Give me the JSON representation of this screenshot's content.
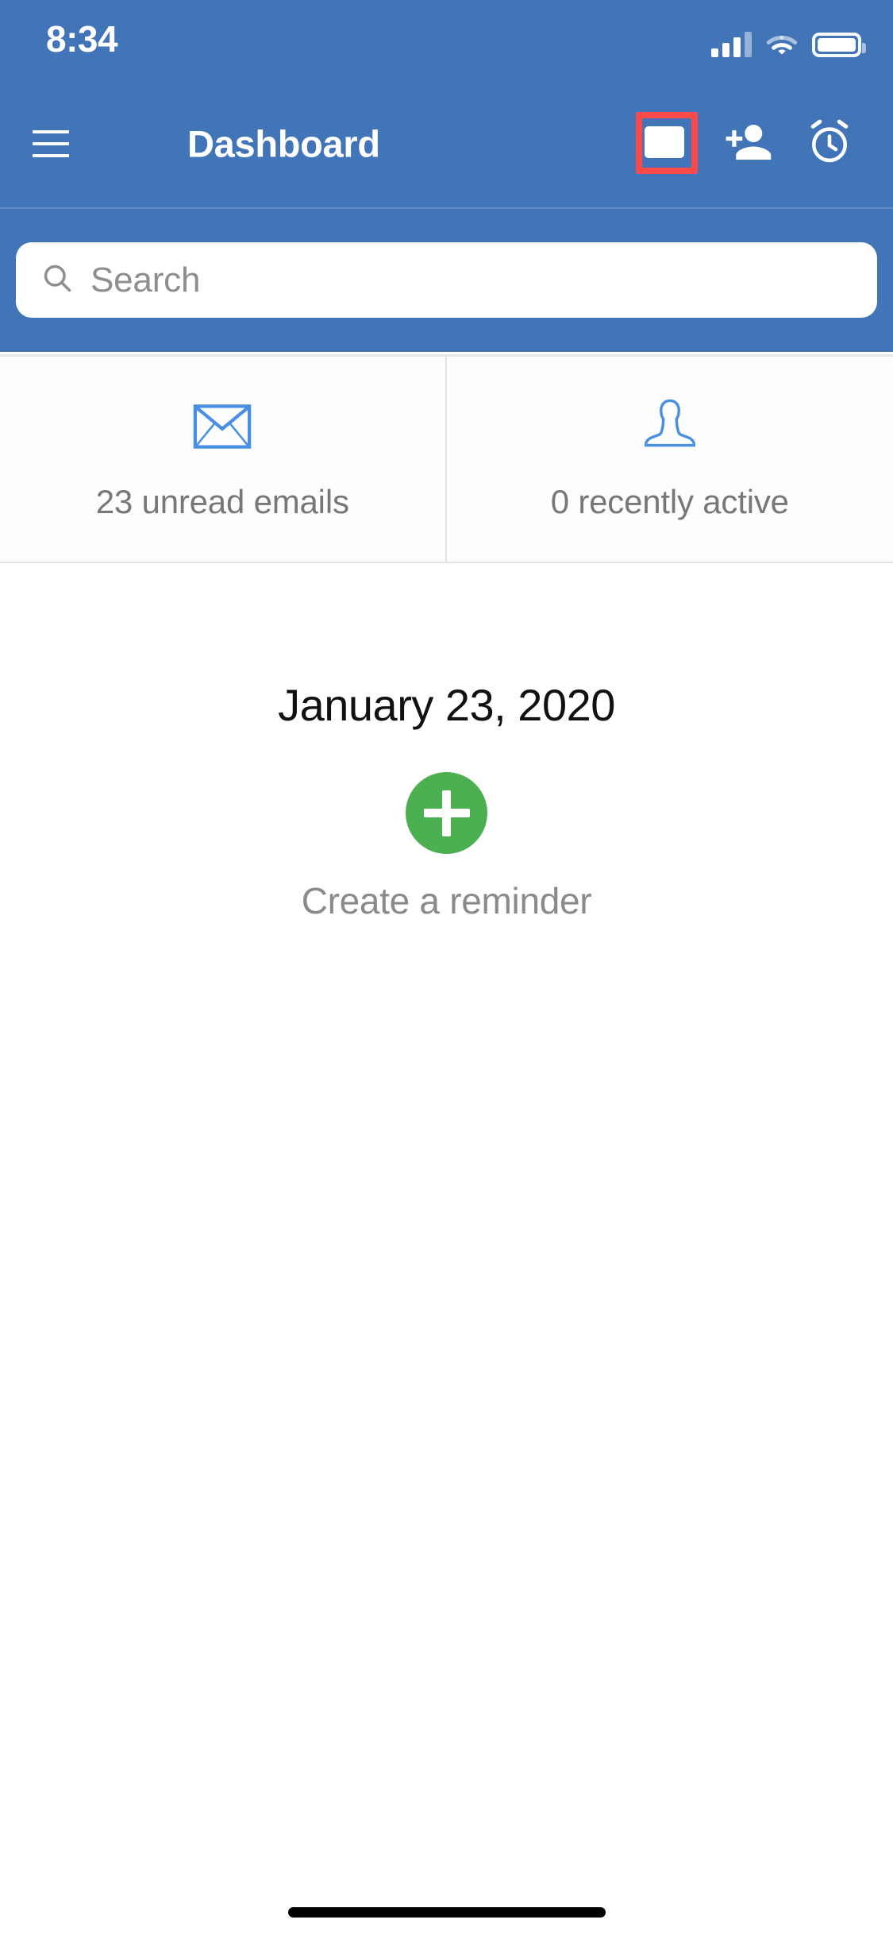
{
  "status_bar": {
    "time": "8:34",
    "signal_icon": "cellular-signal-icon",
    "wifi_icon": "wifi-icon",
    "battery_icon": "battery-full-icon"
  },
  "nav_bar": {
    "menu_icon": "hamburger-menu-icon",
    "title": "Dashboard",
    "actions": [
      {
        "icon": "mail-envelope-icon",
        "name": "messages-button",
        "highlighted": true
      },
      {
        "icon": "person-add-icon",
        "name": "add-contact-button",
        "highlighted": false
      },
      {
        "icon": "alarm-clock-icon",
        "name": "alarms-button",
        "highlighted": false
      }
    ],
    "highlight_color": "#fa4a4a",
    "bar_color": "#4274b8"
  },
  "search": {
    "placeholder": "Search",
    "value": "",
    "icon": "search-icon"
  },
  "stat_cards": [
    {
      "icon": "envelope-outline-icon",
      "label": "23 unread emails",
      "count": 23,
      "name": "unread-emails-card"
    },
    {
      "icon": "person-outline-icon",
      "label": "0 recently active",
      "count": 0,
      "name": "recently-active-card"
    }
  ],
  "main": {
    "date": "January 23, 2020",
    "reminder": {
      "icon": "plus-circle-icon",
      "label": "Create a reminder",
      "accent_color": "#4caf50"
    }
  },
  "colors": {
    "brand_blue": "#4274b8",
    "icon_blue": "#4a90e2",
    "green": "#4caf50",
    "highlight_red": "#fa4a4a",
    "muted_text": "#7d7d7d"
  }
}
